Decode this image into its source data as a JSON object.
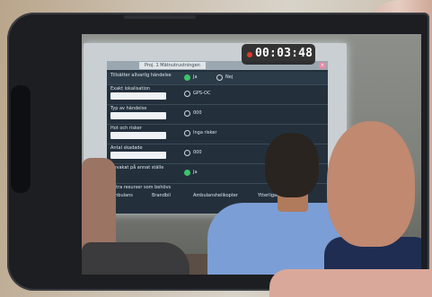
{
  "recording": {
    "timer": "00:03:48"
  },
  "projection": {
    "tab_label": "Proj. 1 Mätnutrustningen",
    "rows": [
      {
        "label": "Tillsätter allvarlig händelse",
        "options": [
          "Ja",
          "Nej"
        ]
      },
      {
        "label": "Exakt lokalisation",
        "options": [
          "GPS-OC"
        ]
      },
      {
        "label": "Typ av händelse",
        "options": [
          "000"
        ]
      },
      {
        "label": "Hot och risker",
        "options": [
          "Inga risker"
        ]
      },
      {
        "label": "Antal skadade",
        "options": [
          "000"
        ]
      },
      {
        "label": "Bevakat på annat ställe",
        "options": [
          "Ja"
        ]
      }
    ],
    "bottom_label": "Extra resurser som behövs",
    "bottom_options": [
      "Ambulans",
      "Brandbil",
      "Ambulanshelikopter",
      "Ytterligare enhet"
    ]
  },
  "colors": {
    "timer_bg": "#1e1e1e",
    "rec_dot": "#e0392b",
    "radio_checked": "#3cc46a",
    "shirt": "#7c9ed6"
  }
}
